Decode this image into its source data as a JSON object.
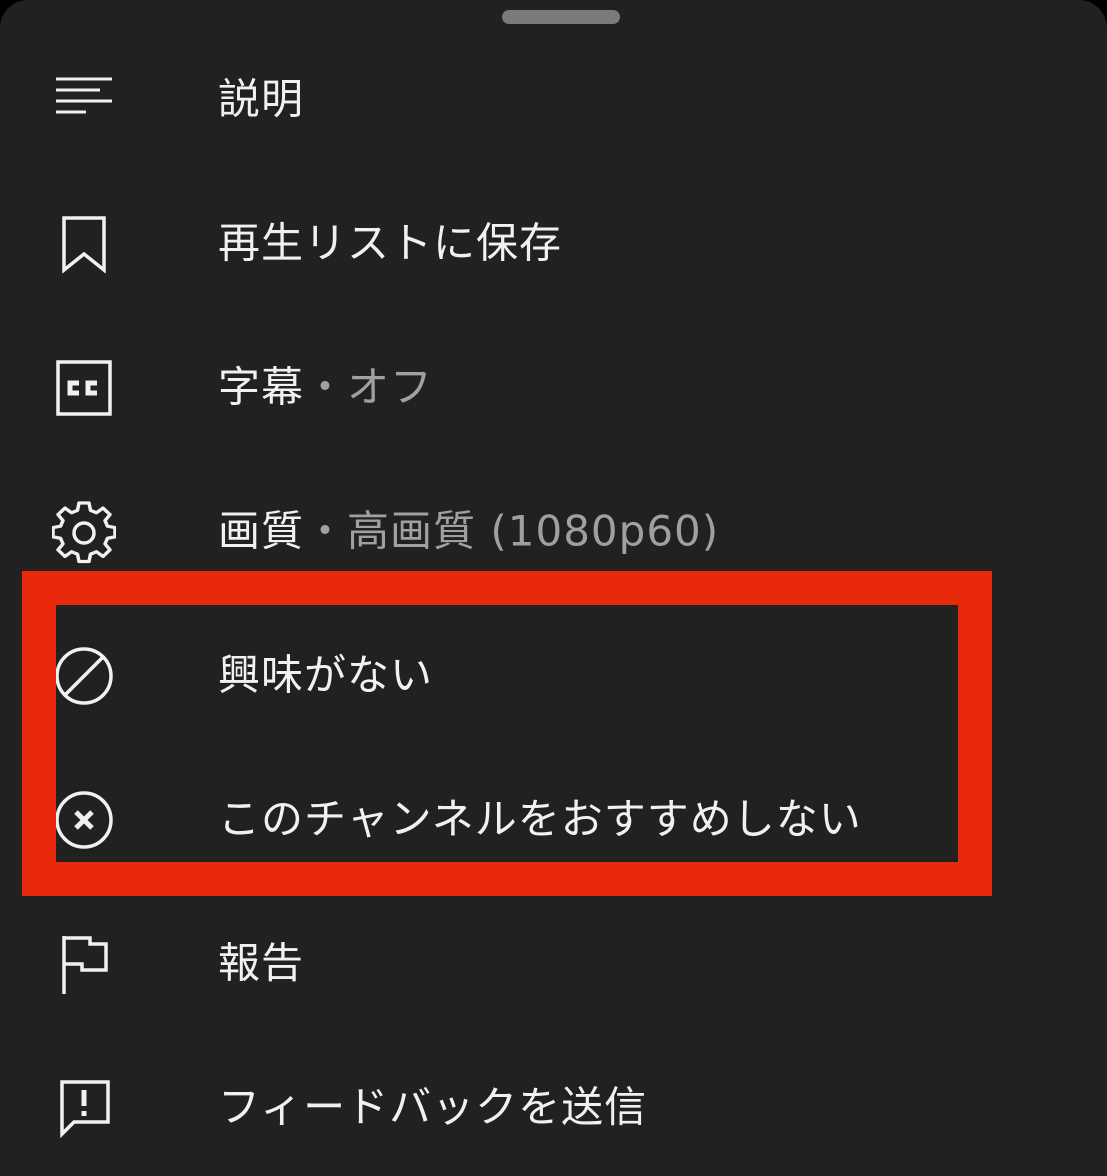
{
  "menu": {
    "items": [
      {
        "id": "description",
        "label": "説明",
        "icon": "description-lines-icon"
      },
      {
        "id": "save-to-playlist",
        "label": "再生リストに保存",
        "icon": "bookmark-icon"
      },
      {
        "id": "captions",
        "label": "字幕",
        "separator": "・",
        "value": "オフ",
        "icon": "closed-captions-icon"
      },
      {
        "id": "quality",
        "label": "画質",
        "separator": "・",
        "value": "高画質 (1080p60)",
        "icon": "gear-icon"
      },
      {
        "id": "not-interested",
        "label": "興味がない",
        "icon": "not-interested-icon"
      },
      {
        "id": "dont-recommend-channel",
        "label": "このチャンネルをおすすめしない",
        "icon": "close-circle-icon"
      },
      {
        "id": "report",
        "label": "報告",
        "icon": "flag-icon"
      },
      {
        "id": "send-feedback",
        "label": "フィードバックを送信",
        "icon": "feedback-icon"
      }
    ]
  },
  "colors": {
    "background": "#212121",
    "text": "#f1f1f1",
    "secondary_text": "#a0a0a0",
    "highlight": "#e8290b"
  }
}
